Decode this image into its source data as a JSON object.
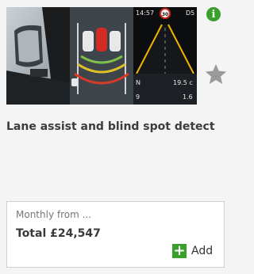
{
  "feature": {
    "title": "Lane assist and blind spot detect",
    "images": [
      {
        "name": "door-mirror-photo"
      },
      {
        "name": "parking-sensor-graphic"
      },
      {
        "name": "dashboard-lane-display",
        "hud": {
          "time": "14:57",
          "gear": "D5",
          "speed_sign": "30",
          "compass": "N",
          "temp": "19.5 c",
          "row_left": "9",
          "row_right": "1.6"
        }
      }
    ],
    "icons": {
      "info": "info-icon",
      "favourite": "star-icon",
      "add": "plus-icon"
    }
  },
  "pricing": {
    "monthly_label": "Monthly from ...",
    "total_label": "Total £24,547"
  },
  "actions": {
    "add_label": "Add"
  },
  "colors": {
    "accent_green": "#3aa02c",
    "star_grey": "#9a9a9a",
    "title_text": "#3c3c3c"
  }
}
